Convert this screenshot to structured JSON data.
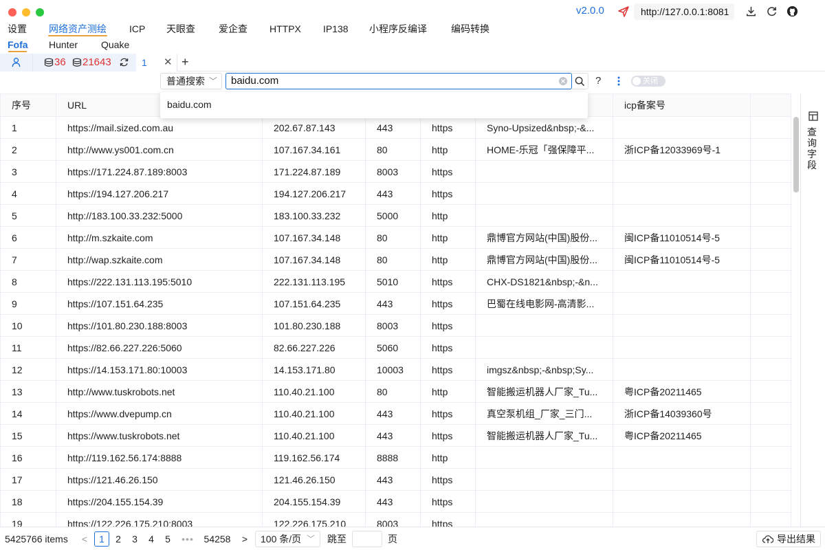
{
  "titlebar": {
    "version": "v2.0.0",
    "url": "http://127.0.0.1:8081",
    "icons": [
      "send-icon",
      "download-icon",
      "refresh-icon",
      "github-icon"
    ]
  },
  "menu": {
    "items": [
      "设置",
      "网络资产测绘",
      "ICP",
      "天眼查",
      "爱企查",
      "HTTPX",
      "IP138",
      "小程序反编译",
      "编码转换"
    ],
    "active_index": 1
  },
  "submenu": {
    "items": [
      "Fofa",
      "Hunter",
      "Quake"
    ],
    "active_index": 0
  },
  "tabs": {
    "stat1": "36",
    "stat2": "21643",
    "active_tab": "1",
    "add_label": "+"
  },
  "search": {
    "mode": "普通搜索",
    "query": "baidu.com",
    "suggestions": [
      "baidu.com"
    ],
    "help": "?",
    "toggle_label": "关闭"
  },
  "table": {
    "headers": [
      "序号",
      "URL",
      "",
      "",
      "",
      "",
      "icp备案号"
    ],
    "rows": [
      [
        "1",
        "https://mail.sized.com.au",
        "202.67.87.143",
        "443",
        "https",
        "Syno-Upsized&nbsp;-&...",
        ""
      ],
      [
        "2",
        "http://www.ys001.com.cn",
        "107.167.34.161",
        "80",
        "http",
        "HOME-乐冠「强保障平...",
        "浙ICP备12033969号-1"
      ],
      [
        "3",
        "https://171.224.87.189:8003",
        "171.224.87.189",
        "8003",
        "https",
        "",
        ""
      ],
      [
        "4",
        "https://194.127.206.217",
        "194.127.206.217",
        "443",
        "https",
        "",
        ""
      ],
      [
        "5",
        "http://183.100.33.232:5000",
        "183.100.33.232",
        "5000",
        "http",
        "",
        ""
      ],
      [
        "6",
        "http://m.szkaite.com",
        "107.167.34.148",
        "80",
        "http",
        "鼎博官方网站(中国)股份...",
        "闽ICP备11010514号-5"
      ],
      [
        "7",
        "http://wap.szkaite.com",
        "107.167.34.148",
        "80",
        "http",
        "鼎博官方网站(中国)股份...",
        "闽ICP备11010514号-5"
      ],
      [
        "8",
        "https://222.131.113.195:5010",
        "222.131.113.195",
        "5010",
        "https",
        "CHX-DS1821&nbsp;-&n...",
        ""
      ],
      [
        "9",
        "https://107.151.64.235",
        "107.151.64.235",
        "443",
        "https",
        "巴蜀在线电影网-高清影...",
        ""
      ],
      [
        "10",
        "https://101.80.230.188:8003",
        "101.80.230.188",
        "8003",
        "https",
        "",
        ""
      ],
      [
        "11",
        "https://82.66.227.226:5060",
        "82.66.227.226",
        "5060",
        "https",
        "",
        ""
      ],
      [
        "12",
        "https://14.153.171.80:10003",
        "14.153.171.80",
        "10003",
        "https",
        "imgsz&nbsp;-&nbsp;Sy...",
        ""
      ],
      [
        "13",
        "http://www.tuskrobots.net",
        "110.40.21.100",
        "80",
        "http",
        "智能搬运机器人厂家_Tu...",
        "粤ICP备20211465"
      ],
      [
        "14",
        "https://www.dvepump.cn",
        "110.40.21.100",
        "443",
        "https",
        "真空泵机组_厂家_三门...",
        "浙ICP备14039360号"
      ],
      [
        "15",
        "https://www.tuskrobots.net",
        "110.40.21.100",
        "443",
        "https",
        "智能搬运机器人厂家_Tu...",
        "粤ICP备20211465"
      ],
      [
        "16",
        "http://119.162.56.174:8888",
        "119.162.56.174",
        "8888",
        "http",
        "",
        ""
      ],
      [
        "17",
        "https://121.46.26.150",
        "121.46.26.150",
        "443",
        "https",
        "",
        ""
      ],
      [
        "18",
        "https://204.155.154.39",
        "204.155.154.39",
        "443",
        "https",
        "",
        ""
      ],
      [
        "19",
        "https://122.226.175.210:8003",
        "122.226.175.210",
        "8003",
        "https",
        "",
        ""
      ]
    ]
  },
  "side_panel": {
    "label": "查询字段"
  },
  "footer": {
    "total": "5425766 items",
    "prev": "<",
    "pages": [
      "1",
      "2",
      "3",
      "4",
      "5"
    ],
    "dots": "•••",
    "last_page": "54258",
    "next": ">",
    "page_size": "100 条/页",
    "jump_label": "跳至",
    "jump_suffix": "页",
    "export_label": "导出结果"
  },
  "colors": {
    "accent": "#1e6fd9",
    "stat_red": "#e03131",
    "underline": "#e6a23c"
  }
}
